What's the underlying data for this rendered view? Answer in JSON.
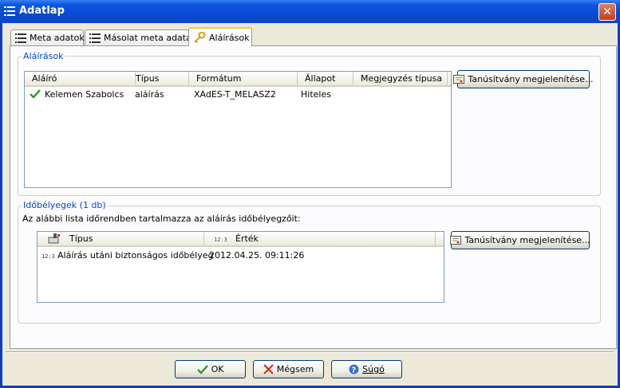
{
  "window": {
    "title": "Adatlap",
    "close_icon": "close-icon"
  },
  "tabs": [
    {
      "label": "Meta adatok",
      "icon": "list-icon"
    },
    {
      "label": "Másolat meta adatai",
      "icon": "list-icon"
    },
    {
      "label": "Aláírások",
      "icon": "key-icon"
    }
  ],
  "signatures": {
    "legend": "Aláírások",
    "columns": [
      "Aláíró",
      "Típus",
      "Formátum",
      "Állapot",
      "Megjegyzés típusa"
    ],
    "rows": [
      {
        "signer": "Kelemen Szabolcs",
        "type": "aláírás",
        "format": "XAdES-T_MELASZ2",
        "status": "Hiteles",
        "note": ""
      }
    ],
    "cert_button": "Tanúsítvány megjelenítése..."
  },
  "timestamps": {
    "legend": "Időbélyegek (1 db)",
    "description": "Az alábbi lista időrendben tartalmazza az aláírás időbélyegzőit:",
    "columns": [
      "Típus",
      "Érték"
    ],
    "rows": [
      {
        "type": "Aláírás utáni biztonságos időbélyeg",
        "value": "2012.04.25. 09:11:26"
      }
    ],
    "cert_button": "Tanúsítvány megjelenítése..."
  },
  "buttons": {
    "ok": "OK",
    "cancel": "Mégsem",
    "help": "Súgó"
  },
  "colors": {
    "title_bar": "#0a49d3",
    "dialog_bg": "#ece9d8",
    "legend_text": "#0046d5",
    "active_tab_accent": "#ffc83c"
  }
}
